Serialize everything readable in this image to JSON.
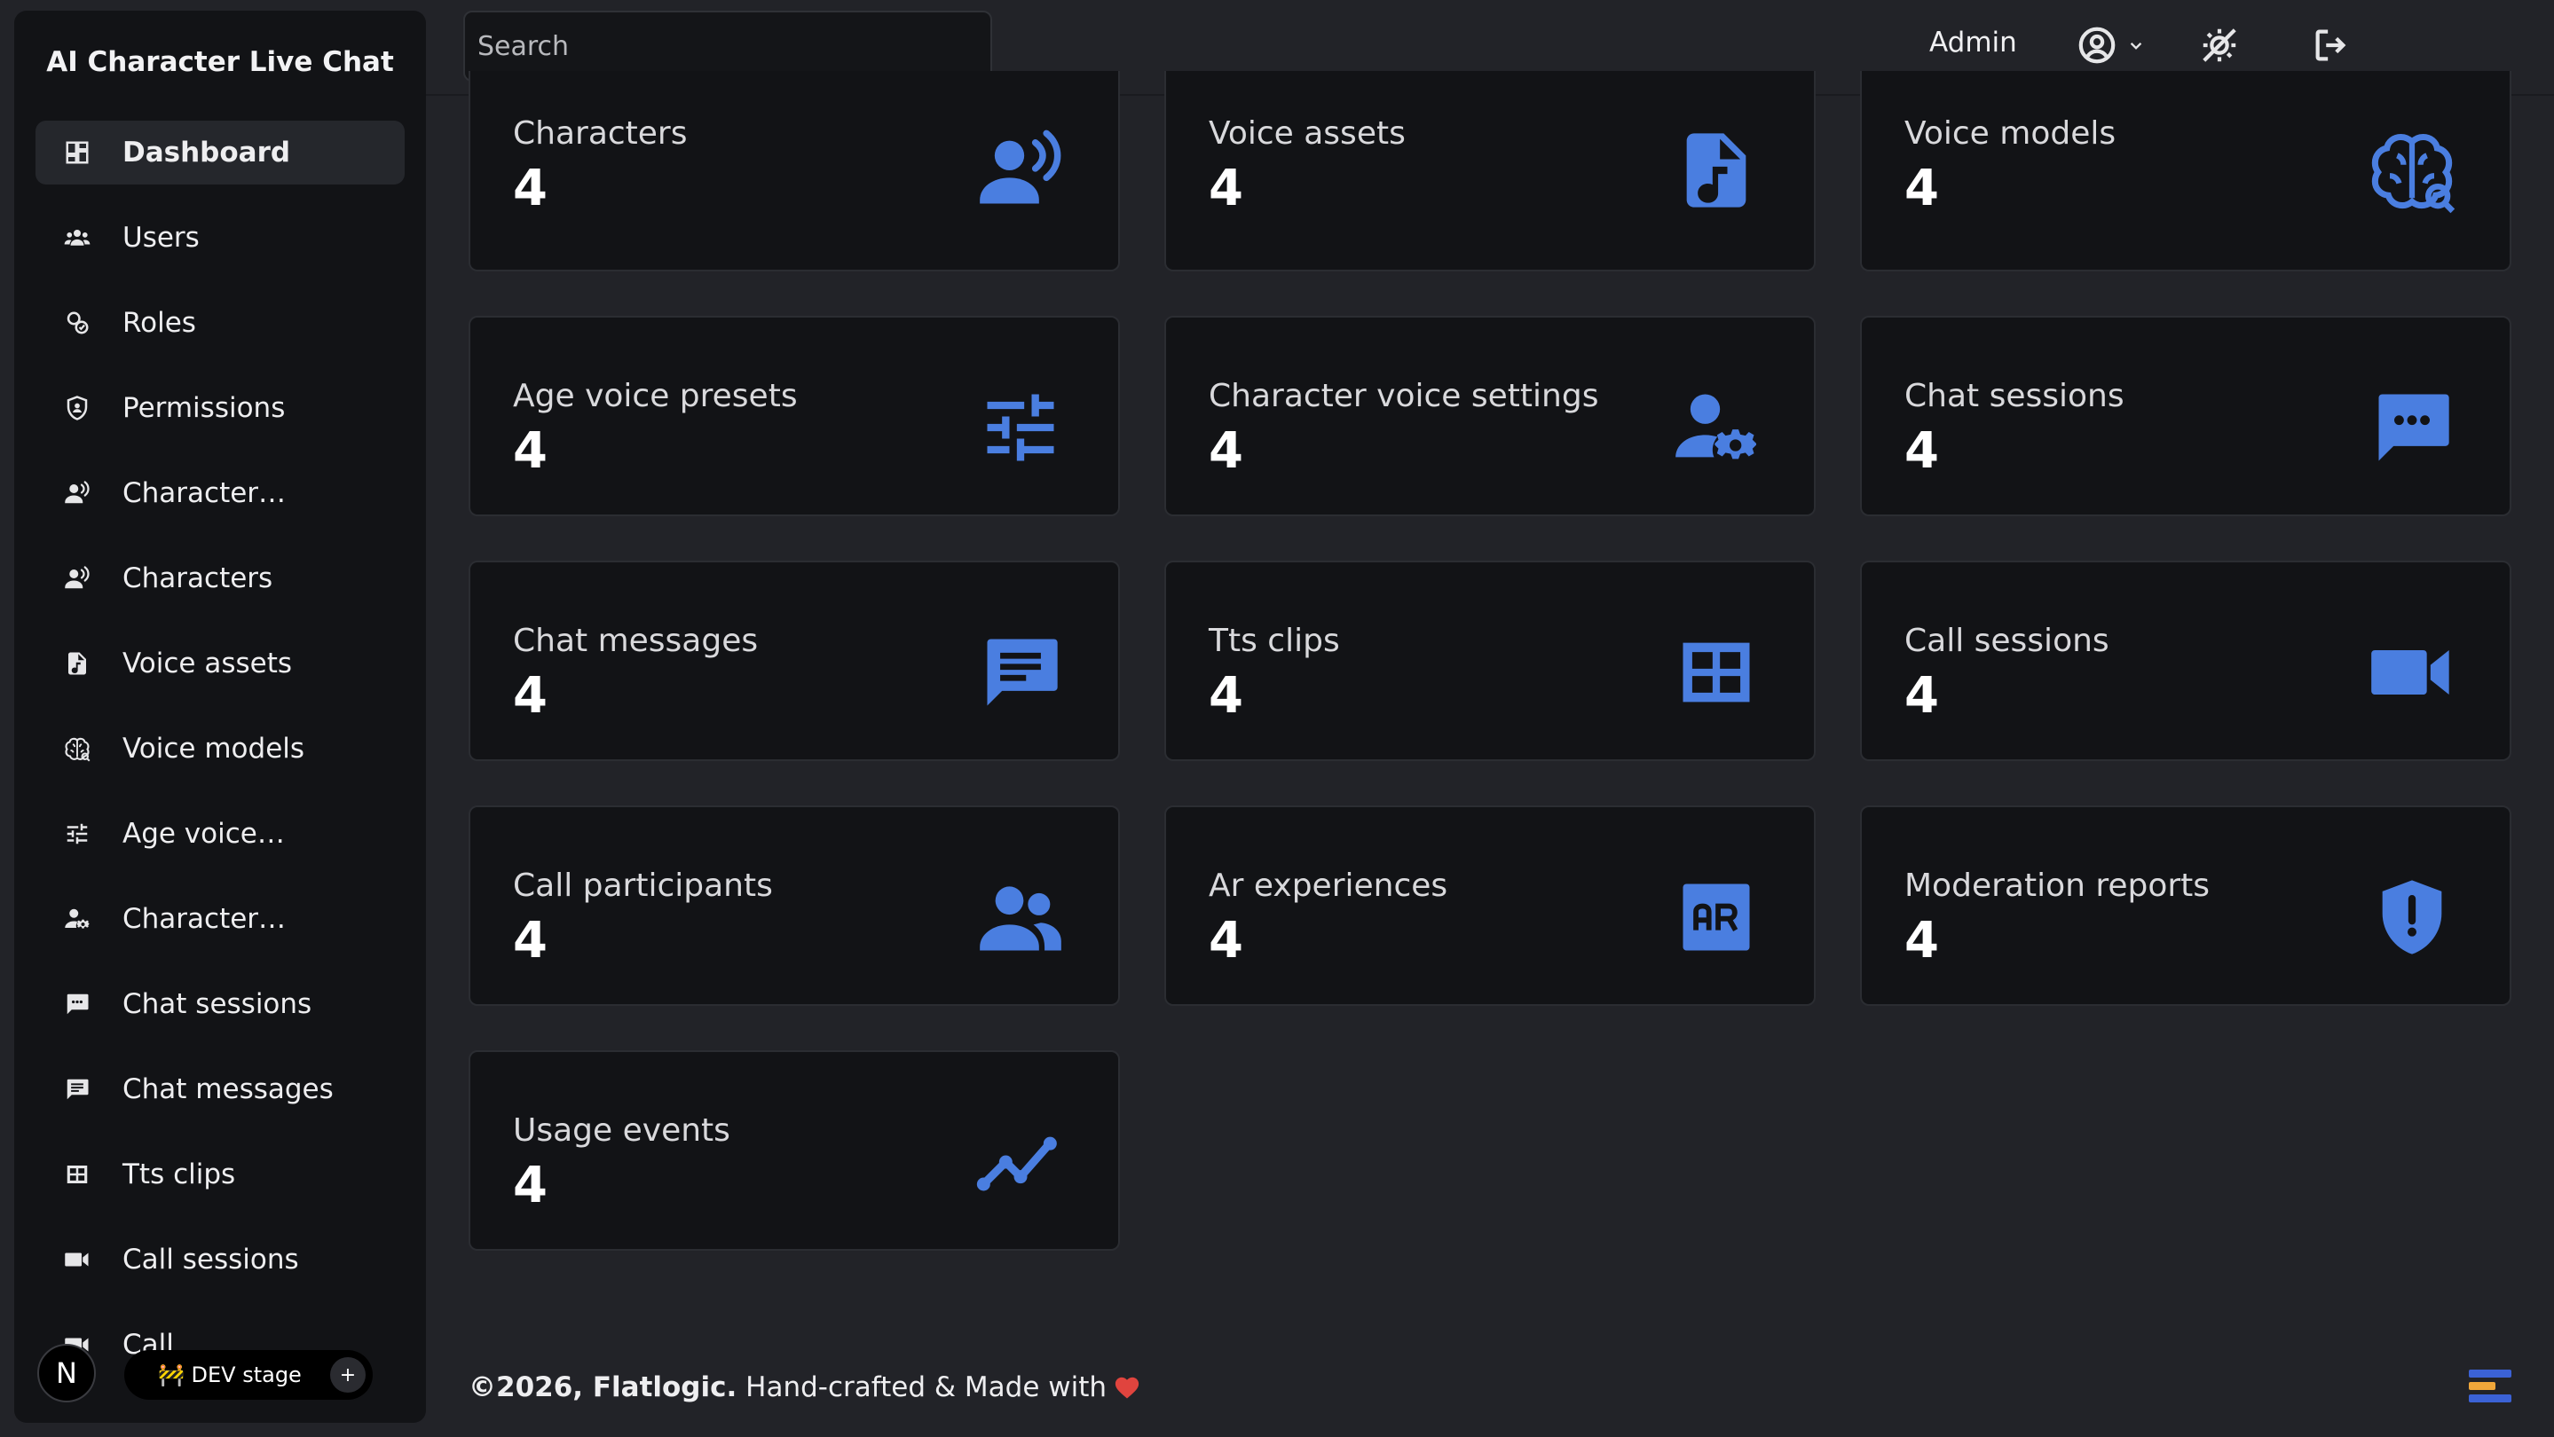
{
  "app": {
    "title": "AI Character Live Chat"
  },
  "sidebar": {
    "items": [
      {
        "label": "Dashboard",
        "icon": "dashboard-icon",
        "active": true
      },
      {
        "label": "Users",
        "icon": "users-icon"
      },
      {
        "label": "Roles",
        "icon": "roles-icon"
      },
      {
        "label": "Permissions",
        "icon": "shield-icon"
      },
      {
        "label": "Character…",
        "icon": "voice-person-icon"
      },
      {
        "label": "Characters",
        "icon": "voice-person-icon"
      },
      {
        "label": "Voice assets",
        "icon": "music-file-icon"
      },
      {
        "label": "Voice models",
        "icon": "brain-icon"
      },
      {
        "label": "Age voice…",
        "icon": "sliders-icon"
      },
      {
        "label": "Character…",
        "icon": "user-gear-icon"
      },
      {
        "label": "Chat sessions",
        "icon": "chat-dots-icon"
      },
      {
        "label": "Chat messages",
        "icon": "message-lines-icon"
      },
      {
        "label": "Tts clips",
        "icon": "table-icon"
      },
      {
        "label": "Call sessions",
        "icon": "video-icon"
      },
      {
        "label": "Call…",
        "icon": "call-icon"
      }
    ]
  },
  "topbar": {
    "search_placeholder": "Search",
    "user_label": "Admin",
    "icons": [
      "user-circle-icon",
      "chevron-down-icon",
      "theme-toggle-icon",
      "logout-icon"
    ]
  },
  "cards": [
    {
      "title": "Characters",
      "value": "4",
      "icon": "voice-person-icon"
    },
    {
      "title": "Voice assets",
      "value": "4",
      "icon": "music-file-icon"
    },
    {
      "title": "Voice models",
      "value": "4",
      "icon": "brain-icon"
    },
    {
      "title": "Age voice presets",
      "value": "4",
      "icon": "sliders-icon"
    },
    {
      "title": "Character voice settings",
      "value": "4",
      "icon": "user-gear-icon"
    },
    {
      "title": "Chat sessions",
      "value": "4",
      "icon": "chat-dots-icon"
    },
    {
      "title": "Chat messages",
      "value": "4",
      "icon": "message-lines-icon"
    },
    {
      "title": "Tts clips",
      "value": "4",
      "icon": "table-icon"
    },
    {
      "title": "Call sessions",
      "value": "4",
      "icon": "video-icon"
    },
    {
      "title": "Call participants",
      "value": "4",
      "icon": "people-icon"
    },
    {
      "title": "Ar experiences",
      "value": "4",
      "icon": "ar-icon"
    },
    {
      "title": "Moderation reports",
      "value": "4",
      "icon": "alert-shield-icon"
    },
    {
      "title": "Usage events",
      "value": "4",
      "icon": "trend-icon"
    }
  ],
  "footer": {
    "copyright": "©2026, Flatlogic.",
    "text": " Hand-crafted & Made with"
  },
  "dev": {
    "n_label": "N",
    "stage_label": "🚧 DEV stage",
    "plus": "+"
  },
  "colors": {
    "accent": "#4a7ee0",
    "background": "#222328",
    "panel": "#121316"
  }
}
